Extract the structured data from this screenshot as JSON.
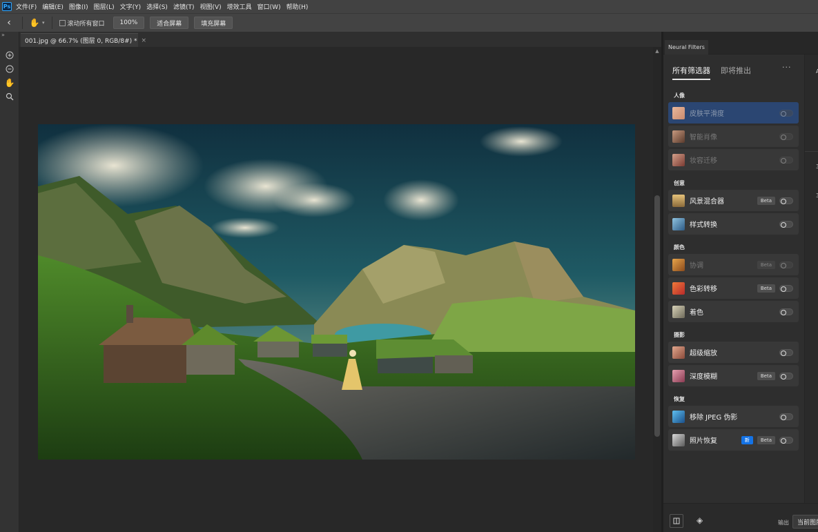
{
  "app": {
    "logo": "Ps",
    "menu": [
      "文件(F)",
      "编辑(E)",
      "图像(I)",
      "图层(L)",
      "文字(Y)",
      "选择(S)",
      "滤镜(T)",
      "视图(V)",
      "增效工具",
      "窗口(W)",
      "帮助(H)"
    ]
  },
  "options": {
    "scroll_all_label": "滚动所有窗口",
    "zoom_100": "100%",
    "fit_screen": "适合屏幕",
    "fill_screen": "填充屏幕"
  },
  "document": {
    "tab_title": "001.jpg @ 66.7% (图层 0, RGB/8#) *",
    "close_glyph": "×"
  },
  "panel": {
    "tab_label": "Neural Filters",
    "tabs": [
      "所有筛选器",
      "即将推出"
    ],
    "more_glyph": "···",
    "categories": {
      "portrait": "人像",
      "creative": "创意",
      "color": "颜色",
      "photography": "摄影",
      "restoration": "恢复"
    },
    "filters": [
      {
        "name": "皮肤平滑度",
        "state": "dim",
        "selected": true,
        "thumb": "#c98a6e"
      },
      {
        "name": "智能肖像",
        "state": "dim",
        "thumb": "#8d5e4a"
      },
      {
        "name": "妆容迁移",
        "state": "dim",
        "thumb": "#a4564a"
      },
      {
        "name": "风景混合器",
        "state": "active",
        "beta": "Beta",
        "thumb": "#d3a35a"
      },
      {
        "name": "样式转换",
        "state": "active",
        "thumb": "#5a8fb8"
      },
      {
        "name": "协调",
        "state": "dim",
        "beta": "Beta",
        "thumb": "#c98a3c"
      },
      {
        "name": "色彩转移",
        "state": "active",
        "beta": "Beta",
        "thumb": "#d8552e"
      },
      {
        "name": "着色",
        "state": "active",
        "thumb": "#9a9a8a"
      },
      {
        "name": "超级缩放",
        "state": "active",
        "thumb": "#c27a5e"
      },
      {
        "name": "深度模糊",
        "state": "active",
        "beta": "Beta",
        "thumb": "#b56a78"
      },
      {
        "name": "移除 JPEG 伪影",
        "state": "active",
        "thumb": "#2c8fd8"
      },
      {
        "name": "照片恢复",
        "state": "active",
        "new": "新",
        "beta": "Beta",
        "thumb": "#8c8c8c"
      }
    ],
    "right_strip": [
      "A",
      "3",
      "3"
    ],
    "output_label": "输出",
    "output_value": "当前图层"
  },
  "colors": {
    "accent_selected": "#2b4672",
    "new_badge": "#1473e6",
    "app_bg": "#2b2b2b"
  },
  "icons": {
    "back": "chevron-left-icon",
    "hand": "hand-icon",
    "zoom_in": "zoom-in-icon",
    "zoom_out": "zoom-out-icon",
    "search": "search-icon",
    "compare": "compare-icon",
    "layers": "layers-icon"
  }
}
